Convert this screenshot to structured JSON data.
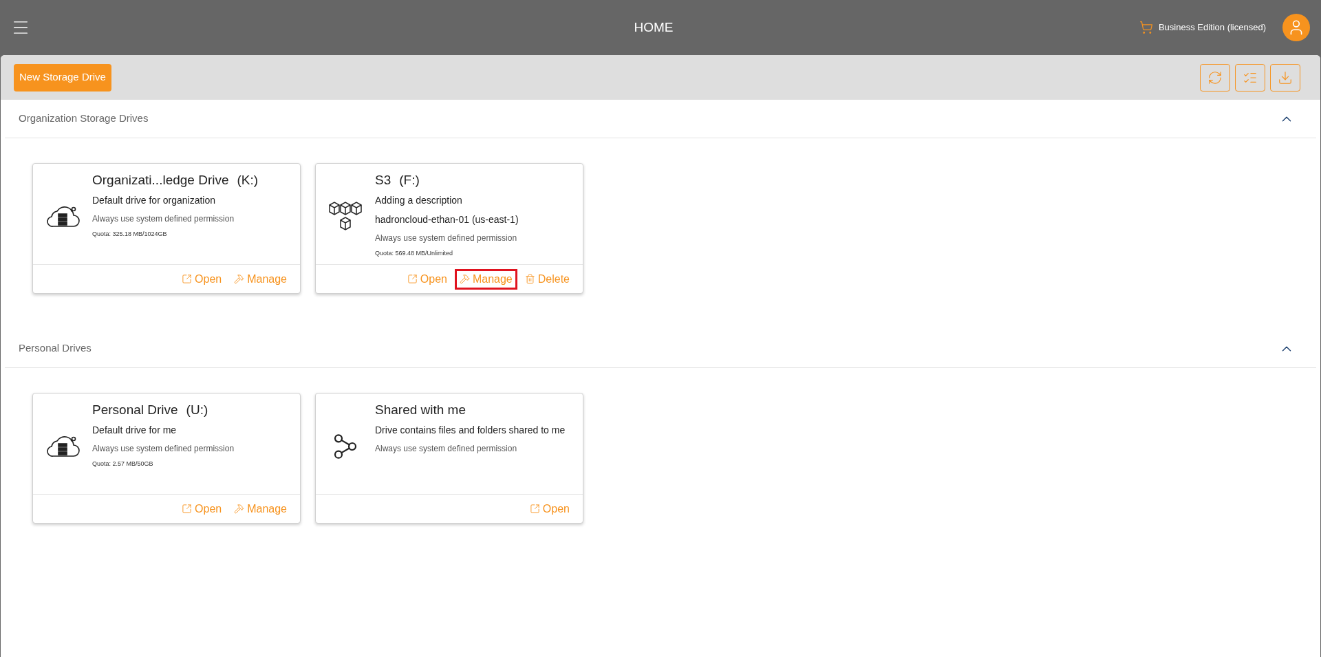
{
  "header": {
    "title": "HOME",
    "edition": "Business Edition (licensed)"
  },
  "toolbar": {
    "new_button": "New Storage Drive"
  },
  "sections": [
    {
      "title": "Organization Storage Drives",
      "expanded": true,
      "drives": [
        {
          "kind": "cloud",
          "name": "Organizati...ledge Drive",
          "letter": "(K:)",
          "lines": [
            {
              "kind": "description",
              "text": "Default drive for organization"
            },
            {
              "kind": "permission",
              "text": "Always use system defined permission"
            },
            {
              "kind": "quota",
              "text": "Quota: 325.18 MB/1024GB"
            }
          ],
          "actions": [
            {
              "kind": "open",
              "label": "Open",
              "highlighted": false
            },
            {
              "kind": "manage",
              "label": "Manage",
              "highlighted": false
            }
          ]
        },
        {
          "kind": "boxes",
          "name": "S3",
          "letter": "(F:)",
          "lines": [
            {
              "kind": "description",
              "text": "Adding a description"
            },
            {
              "kind": "description",
              "text": "hadroncloud-ethan-01 (us-east-1)"
            },
            {
              "kind": "permission",
              "text": "Always use system defined permission"
            },
            {
              "kind": "quota",
              "text": "Quota: 569.48 MB/Unlimited"
            }
          ],
          "actions": [
            {
              "kind": "open",
              "label": "Open",
              "highlighted": false
            },
            {
              "kind": "manage",
              "label": "Manage",
              "highlighted": true
            },
            {
              "kind": "delete",
              "label": "Delete",
              "highlighted": false
            }
          ]
        }
      ]
    },
    {
      "title": "Personal Drives",
      "expanded": true,
      "drives": [
        {
          "kind": "cloud",
          "name": "Personal Drive",
          "letter": "(U:)",
          "lines": [
            {
              "kind": "description",
              "text": "Default drive for me"
            },
            {
              "kind": "permission",
              "text": "Always use system defined permission"
            },
            {
              "kind": "quota",
              "text": "Quota: 2.57 MB/50GB"
            }
          ],
          "actions": [
            {
              "kind": "open",
              "label": "Open",
              "highlighted": false
            },
            {
              "kind": "manage",
              "label": "Manage",
              "highlighted": false
            }
          ]
        },
        {
          "kind": "share",
          "name": "Shared with me",
          "lines": [
            {
              "kind": "description",
              "text": "Drive contains files and folders shared to me"
            },
            {
              "kind": "permission",
              "text": "Always use system defined permission"
            }
          ],
          "actions": [
            {
              "kind": "open",
              "label": "Open",
              "highlighted": false
            }
          ]
        }
      ]
    }
  ]
}
